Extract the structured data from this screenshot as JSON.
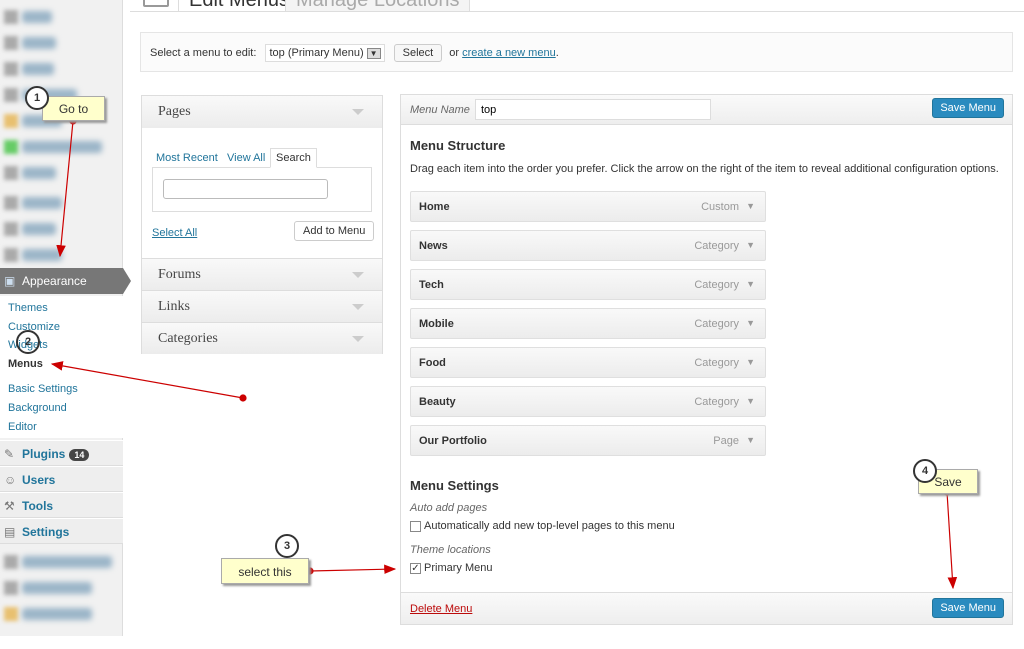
{
  "sidebar": {
    "appearance": "Appearance",
    "submenu": [
      "Themes",
      "Customize",
      "Widgets",
      "Menus",
      "Basic Settings",
      "Background",
      "Editor"
    ],
    "plugins": "Plugins",
    "plugins_badge": "14",
    "users": "Users",
    "tools": "Tools",
    "settings": "Settings"
  },
  "tabs": {
    "edit": "Edit Menus",
    "manage": "Manage Locations"
  },
  "selbar": {
    "label": "Select a menu to edit:",
    "selected": "top (Primary Menu)",
    "select_btn": "Select",
    "or": "or",
    "create_link": "create a new menu",
    "period": "."
  },
  "left": {
    "pages": "Pages",
    "tabs": [
      "Most Recent",
      "View All",
      "Search"
    ],
    "select_all": "Select All",
    "add": "Add to Menu",
    "forums": "Forums",
    "links": "Links",
    "categories": "Categories"
  },
  "right": {
    "menu_name_label": "Menu Name",
    "menu_name": "top",
    "save": "Save Menu",
    "structure_title": "Menu Structure",
    "structure_desc": "Drag each item into the order you prefer. Click the arrow on the right of the item to reveal additional configuration options.",
    "items": [
      {
        "title": "Home",
        "type": "Custom"
      },
      {
        "title": "News",
        "type": "Category"
      },
      {
        "title": "Tech",
        "type": "Category"
      },
      {
        "title": "Mobile",
        "type": "Category"
      },
      {
        "title": "Food",
        "type": "Category"
      },
      {
        "title": "Beauty",
        "type": "Category"
      },
      {
        "title": "Our Portfolio",
        "type": "Page"
      }
    ],
    "settings_title": "Menu Settings",
    "auto_add_label": "Auto add pages",
    "auto_add_text": "Automatically add new top-level pages to this menu",
    "auto_add_checked": false,
    "theme_loc_label": "Theme locations",
    "primary_menu": "Primary Menu",
    "primary_checked": true,
    "delete": "Delete Menu"
  },
  "annotations": [
    {
      "num": "1",
      "text": "Go to"
    },
    {
      "num": "2",
      "text": ""
    },
    {
      "num": "3",
      "text": "select this"
    },
    {
      "num": "4",
      "text": "Save"
    }
  ],
  "colors": {
    "accent": "#2a8bbf",
    "link": "#21759b",
    "arrow": "#cc0000",
    "callout": "#ffffcc"
  }
}
